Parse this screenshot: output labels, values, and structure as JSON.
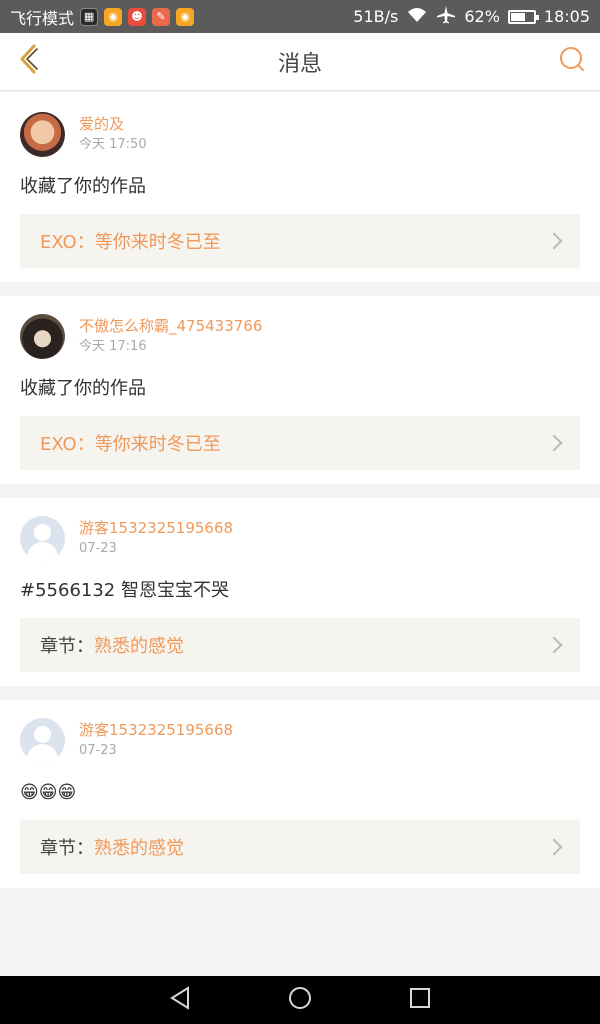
{
  "status_bar": {
    "mode_text": "飞行模式",
    "speed": "51B/s",
    "battery": "62%",
    "battery_level": 0.62,
    "time": "18:05",
    "app_icons": [
      "wallpaper-app-icon",
      "weibo-icon",
      "game-icon",
      "xiaohongshu-icon",
      "weibo-icon"
    ]
  },
  "header": {
    "title": "消息",
    "back_icon": "back-chevron-icon",
    "search_icon": "search-icon"
  },
  "messages": [
    {
      "user": "爱的及",
      "time": "今天 17:50",
      "text": "收藏了你的作品",
      "ref_label": "EXO：",
      "ref_title": "等你来时冬已至"
    },
    {
      "user": "不傲怎么称霸_475433766",
      "time": "今天 17:16",
      "text": "收藏了你的作品",
      "ref_label": "EXO：",
      "ref_title": "等你来时冬已至"
    },
    {
      "user": "游客1532325195668",
      "time": "07-23",
      "text": "#5566132 智恩宝宝不哭",
      "ref_label": "章节：",
      "ref_title": "熟悉的感觉"
    },
    {
      "user": "游客1532325195668",
      "time": "07-23",
      "text": "😁😁😁",
      "ref_label": "章节：",
      "ref_title": "熟悉的感觉"
    }
  ],
  "colors": {
    "accent": "#f0995a",
    "back_icon": "#d8a23a"
  }
}
